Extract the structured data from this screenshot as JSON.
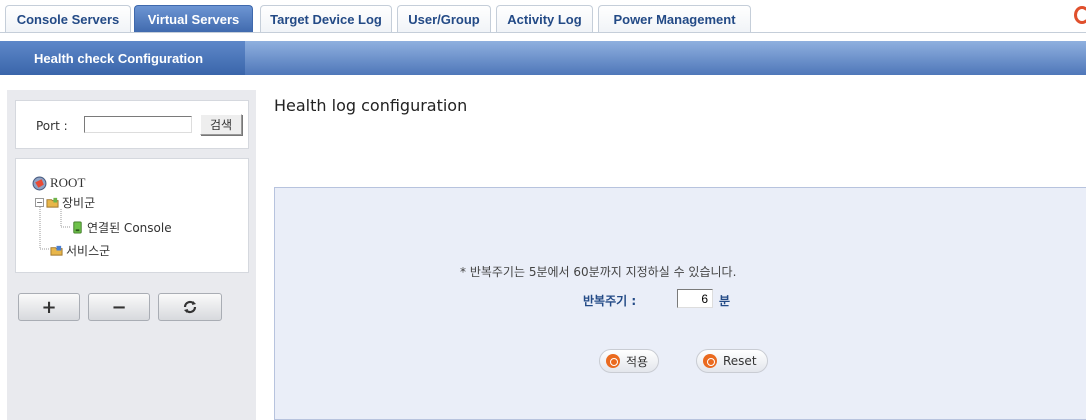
{
  "tabs": [
    {
      "label": "Console Servers",
      "active": false
    },
    {
      "label": "Virtual Servers",
      "active": true
    },
    {
      "label": "Target Device Log",
      "active": false
    },
    {
      "label": "User/Group",
      "active": false
    },
    {
      "label": "Activity Log",
      "active": false
    },
    {
      "label": "Power Management",
      "active": false
    }
  ],
  "subnav": {
    "title": "Health check Configuration"
  },
  "search": {
    "label": "Port :",
    "value": "",
    "button": "검색"
  },
  "tree": {
    "root": "ROOT",
    "group1": "장비군",
    "child1": "연결된 Console",
    "group2": "서비스군"
  },
  "tree_buttons": {
    "add": "+",
    "remove": "−",
    "refresh": "refresh-icon"
  },
  "main": {
    "title": "Health log configuration",
    "note": "* 반복주기는 5분에서 60분까지 지정하실 수 있습니다.",
    "cycle_label": "반복주기 :",
    "cycle_value": "6",
    "cycle_unit": "분",
    "apply_button": "적용",
    "reset_button": "Reset"
  },
  "colors": {
    "accent": "#3f69ad",
    "brand_orange": "#ea6a1f"
  }
}
